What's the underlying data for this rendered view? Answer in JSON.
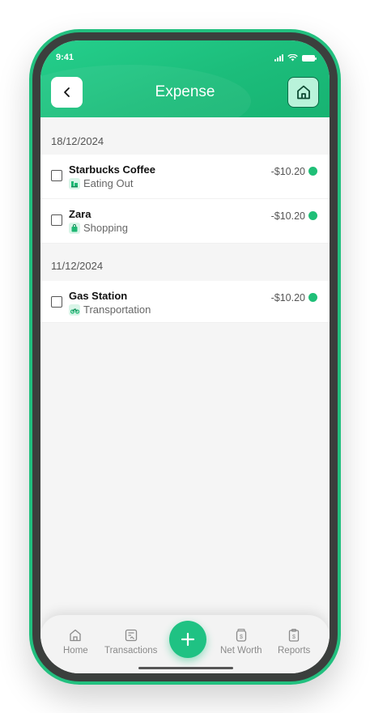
{
  "status_bar": {
    "time": "9:41"
  },
  "header": {
    "title": "Expense"
  },
  "groups": [
    {
      "date": "18/12/2024",
      "items": [
        {
          "name": "Starbucks Coffee",
          "category": "Eating Out",
          "category_icon": "restaurant-icon",
          "amount": "-$10.20"
        },
        {
          "name": "Zara",
          "category": "Shopping",
          "category_icon": "shopping-bag-icon",
          "amount": "-$10.20"
        }
      ]
    },
    {
      "date": "11/12/2024",
      "items": [
        {
          "name": "Gas Station",
          "category": "Transportation",
          "category_icon": "motorbike-icon",
          "amount": "-$10.20"
        }
      ]
    }
  ],
  "bottom_nav": {
    "items": [
      {
        "label": "Home",
        "icon": "home-icon"
      },
      {
        "label": "Transactions",
        "icon": "transactions-icon"
      },
      {
        "label": "Net Worth",
        "icon": "jar-dollar-icon"
      },
      {
        "label": "Reports",
        "icon": "report-dollar-icon"
      }
    ],
    "fab_icon": "plus-icon"
  },
  "colors": {
    "accent": "#1fc283",
    "header": "#1cbd7b",
    "status_dot": "#1fbf77"
  }
}
